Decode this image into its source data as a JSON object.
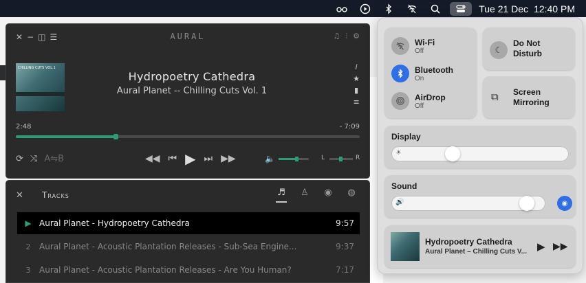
{
  "menubar": {
    "icons": [
      "glasses-icon",
      "play-circle-icon",
      "bluetooth-icon",
      "wifi-off-icon",
      "search-icon",
      "control-center-icon"
    ],
    "date": "Tue 21 Dec",
    "time": "12:40 PM"
  },
  "player": {
    "app_title": "AURAL",
    "now_playing": {
      "title": "Hydropoetry Cathedra",
      "artist_album": "Aural Planet -- Chilling Cuts Vol. 1",
      "cover_text": "CHILLING CUTS VOL.1"
    },
    "elapsed": "2:48",
    "remaining": "- 7:09",
    "progress": 0.29,
    "volume": 0.6,
    "balance_left": "L",
    "balance_right": "R",
    "ab_label": "A⇋B"
  },
  "tracks": {
    "title": "Tracks",
    "rows": [
      {
        "num": "▶",
        "name": "Aural Planet - Hydropoetry Cathedra",
        "duration": "9:57",
        "playing": true
      },
      {
        "num": "2",
        "name": "Aural Planet - Acoustic Plantation Releases - Sub-Sea Engine...",
        "duration": "9:37",
        "playing": false
      },
      {
        "num": "3",
        "name": "Aural Planet - Acoustic Plantation Releases - Are You Human?",
        "duration": "7:17",
        "playing": false
      }
    ]
  },
  "control_center": {
    "wifi": {
      "name": "Wi-Fi",
      "state": "Off"
    },
    "bluetooth": {
      "name": "Bluetooth",
      "state": "On"
    },
    "airdrop": {
      "name": "AirDrop",
      "state": "Off"
    },
    "dnd": {
      "line1": "Do Not",
      "line2": "Disturb"
    },
    "mirroring": {
      "line1": "Screen",
      "line2": "Mirroring"
    },
    "display": {
      "label": "Display",
      "level": 0.33
    },
    "sound": {
      "label": "Sound",
      "level": 0.92
    },
    "now_playing": {
      "title": "Hydropoetry Cathedra",
      "subtitle": "Aural Planet – Chilling Cuts V..."
    }
  }
}
